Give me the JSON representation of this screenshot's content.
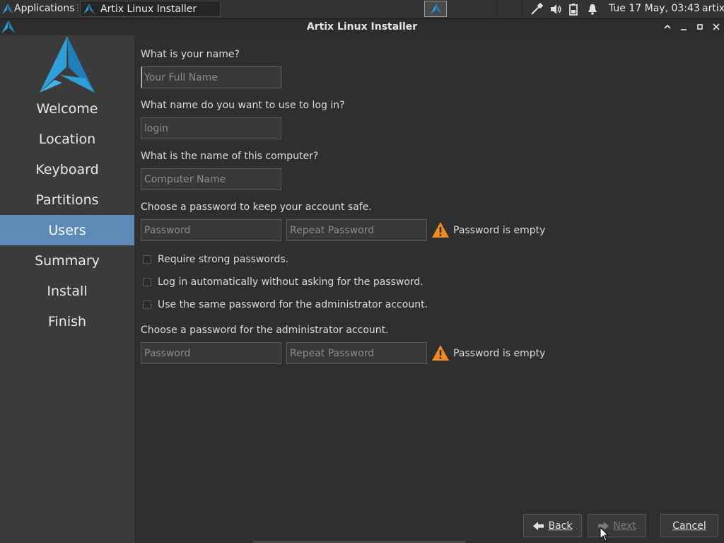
{
  "panel": {
    "applications_label": "Applications",
    "task_label": "Artix Linux Installer",
    "clock": "Tue 17 May, 03:43",
    "user": "artix",
    "tray_icons": [
      "network-wired-icon",
      "volume-icon",
      "battery-icon",
      "notification-bell-icon"
    ]
  },
  "window": {
    "title": "Artix Linux Installer",
    "controls": [
      "maximize-up-icon",
      "minimize-icon",
      "restore-icon",
      "close-icon"
    ]
  },
  "sidebar": {
    "items": [
      {
        "label": "Welcome",
        "active": false
      },
      {
        "label": "Location",
        "active": false
      },
      {
        "label": "Keyboard",
        "active": false
      },
      {
        "label": "Partitions",
        "active": false
      },
      {
        "label": "Users",
        "active": true
      },
      {
        "label": "Summary",
        "active": false
      },
      {
        "label": "Install",
        "active": false
      },
      {
        "label": "Finish",
        "active": false
      }
    ]
  },
  "form": {
    "name_question": "What is your name?",
    "name_placeholder": "Your Full Name",
    "login_question": "What name do you want to use to log in?",
    "login_placeholder": "login",
    "computer_question": "What is the name of this computer?",
    "computer_placeholder": "Computer Name",
    "password_question": "Choose a password to keep your account safe.",
    "password_placeholder": "Password",
    "repeat_placeholder": "Repeat Password",
    "password_status": "Password is empty",
    "checkboxes": [
      {
        "label": "Require strong passwords.",
        "checked": false
      },
      {
        "label": "Log in automatically without asking for the password.",
        "checked": false
      },
      {
        "label": "Use the same password for the administrator account.",
        "checked": false
      }
    ],
    "admin_question": "Choose a password for the administrator account.",
    "admin_password_placeholder": "Password",
    "admin_repeat_placeholder": "Repeat Password",
    "admin_status": "Password is empty"
  },
  "buttons": {
    "back": "Back",
    "next": "Next",
    "cancel": "Cancel"
  },
  "colors": {
    "accent": "#5c8bb7",
    "logo": "#2e9fd8",
    "warning": "#f08a24"
  }
}
